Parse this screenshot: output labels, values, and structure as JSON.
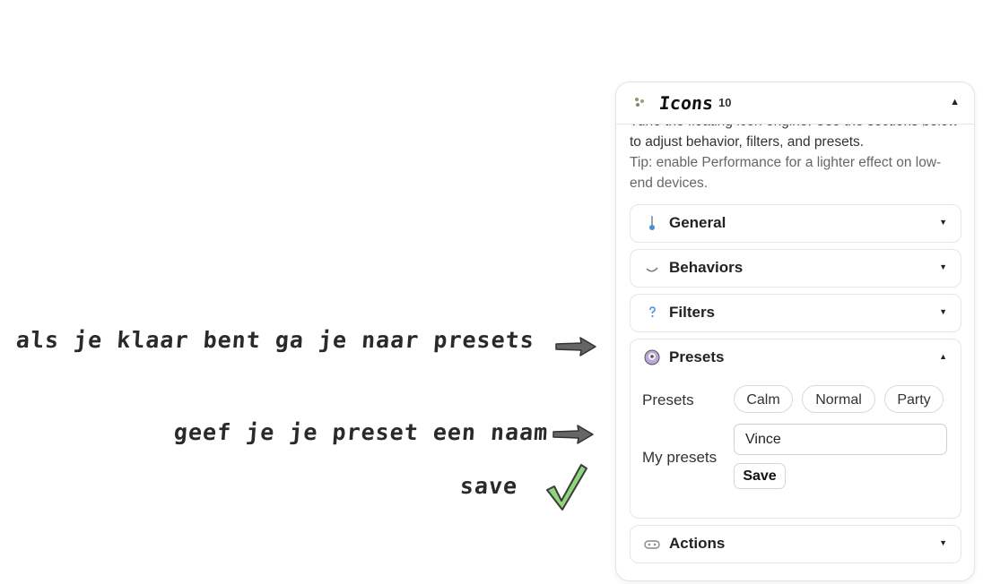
{
  "annotations": {
    "step1": "als je klaar bent ga je naar presets",
    "step2": "geef je je preset een naam",
    "step3": "save"
  },
  "panel": {
    "title": "Icons",
    "count": "10",
    "collapse_caret": "▲",
    "intro_text": "Tune the floating icon engine. Use the sections below to adjust behavior, filters, and presets.",
    "tip_text": "Tip: enable Performance for a lighter effect on low-end devices."
  },
  "sections": {
    "general": {
      "title": "General",
      "caret": "▼"
    },
    "behaviors": {
      "title": "Behaviors",
      "caret": "▼"
    },
    "filters": {
      "title": "Filters",
      "caret": "▼"
    },
    "presets": {
      "title": "Presets",
      "caret": "▲",
      "presets_label": "Presets",
      "options": [
        "Calm",
        "Normal",
        "Party"
      ],
      "my_presets_label": "My presets",
      "name_value": "Vince",
      "save_label": "Save"
    },
    "actions": {
      "title": "Actions",
      "caret": "▼"
    }
  },
  "colors": {
    "check_green": "#8fd57a",
    "arrow_gray": "#666666",
    "accent_blue": "#4a90d9"
  }
}
